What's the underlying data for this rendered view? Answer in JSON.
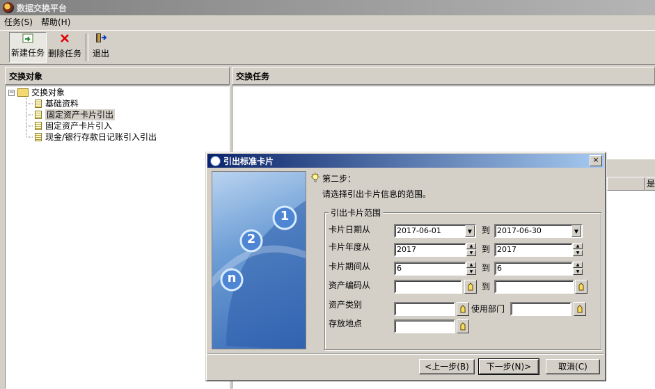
{
  "app": {
    "title": "数据交换平台"
  },
  "menu": {
    "items": [
      "任务(S)",
      "帮助(H)"
    ]
  },
  "toolbar": {
    "new_task": "新建任务",
    "delete_task": "删除任务",
    "exit": "退出"
  },
  "left_panel": {
    "header": "交换对象",
    "tree": {
      "root": "交换对象",
      "children": [
        "基础资料",
        "固定资产卡片引出",
        "固定资产卡片引入",
        "现金/银行存款日记账引入引出"
      ],
      "selected": "固定资产卡片引出"
    }
  },
  "right_panel": {
    "header": "交换任务",
    "column_fragment": "是"
  },
  "dialog": {
    "title": "引出标准卡片",
    "close": "×",
    "step_title": "第二步：",
    "instruction": "请选择引出卡片信息的范围。",
    "group_title": "引出卡片范围",
    "labels": {
      "card_date_from": "卡片日期从",
      "card_year_from": "卡片年度从",
      "card_period_from": "卡片期间从",
      "asset_code_from": "资产编码从",
      "asset_category": "资产类别",
      "use_department": "使用部门",
      "storage_location": "存放地点",
      "to": "到"
    },
    "values": {
      "date_from": "2017-06-01",
      "date_to": "2017-06-30",
      "year_from": "2017",
      "year_to": "2017",
      "period_from": "6",
      "period_to": "6",
      "code_from": "",
      "code_to": "",
      "category": "",
      "department": "",
      "location": ""
    },
    "buttons": {
      "prev": "<上一步(B)",
      "next": "下一步(N)>",
      "cancel": "取消(C)"
    },
    "art_numbers": [
      "1",
      "2",
      "n"
    ]
  },
  "colors": {
    "dialog_title": "#0a246a",
    "window_title_inactive": "#808080"
  }
}
